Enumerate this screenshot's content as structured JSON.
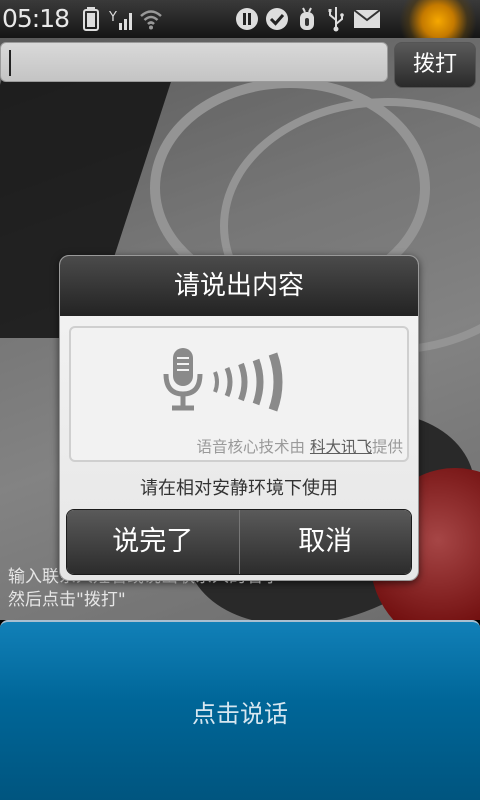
{
  "status_bar": {
    "time": "05:18",
    "icons": [
      "battery-icon",
      "signal-icon",
      "wifi-icon",
      "pause-circle-icon",
      "check-circle-icon",
      "bug-icon",
      "usb-icon",
      "mail-icon"
    ]
  },
  "dial": {
    "input_value": "",
    "button_label": "拨打"
  },
  "hint": {
    "line1": "输入联系人姓名或说出联系人的名字",
    "line2": "然后点击\"拨打\""
  },
  "dialog": {
    "title": "请说出内容",
    "credit_prefix": "语音核心技术由 ",
    "credit_link": "科大讯飞",
    "credit_suffix": "提供",
    "environment_hint": "请在相对安静环境下使用",
    "done_label": "说完了",
    "cancel_label": "取消"
  },
  "speak": {
    "label": "点击说话"
  },
  "colors": {
    "speak_button": "#006698",
    "dialog_header": "#333333",
    "mic_icon": "#8a8a8a"
  }
}
